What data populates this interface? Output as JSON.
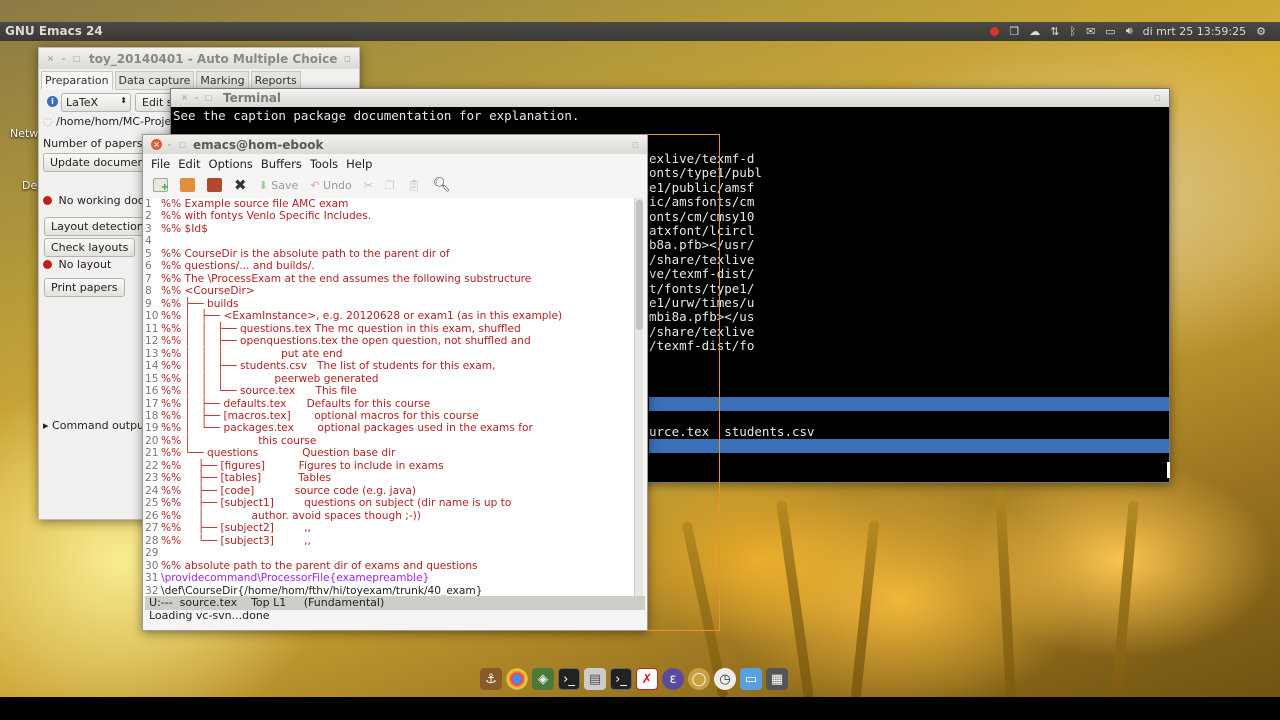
{
  "panel": {
    "app_title": "GNU Emacs 24",
    "datetime": "di mrt 25  13:59:25"
  },
  "desktop": {
    "label1": "Netw",
    "label2": "De"
  },
  "amc": {
    "title": "toy_20140401 - Auto Multiple Choice",
    "tabs": [
      "Preparation",
      "Data capture",
      "Marking",
      "Reports"
    ],
    "format_value": "LaTeX",
    "edit_label": "Edit so",
    "path": "/home/hom/MC-Proje",
    "num_papers_label": "Number of papers:",
    "update_btn": "Update document",
    "no_working_doc": "No working docu",
    "layout_detection_btn": "Layout detection",
    "check_layouts_btn": "Check layouts",
    "no_layout": "No layout",
    "print_papers_btn": "Print papers",
    "command_output": "Command output"
  },
  "terminal": {
    "title": "Terminal",
    "top_line": "See the caption package documentation for explanation.",
    "right_lines": [
      "exlive/texmf-d",
      "onts/type1/publ",
      "e1/public/amsf",
      "ic/amsfonts/cm",
      "onts/cm/cmsy10",
      "atxfont/lcircl",
      "b8a.pfb></usr/",
      "/share/texlive",
      "ve/texmf-dist/",
      "t/fonts/type1/",
      "e1/urw/times/u",
      "mbi8a.pfb></us",
      "/share/texlive",
      "/texmf-dist/fo"
    ],
    "files_line": "urce.tex  students.csv"
  },
  "emacs": {
    "title": "emacs@hom-ebook",
    "menu": [
      "File",
      "Edit",
      "Options",
      "Buffers",
      "Tools",
      "Help"
    ],
    "toolbar_save": "Save",
    "toolbar_undo": "Undo",
    "lines": [
      {
        "n": "1",
        "t": "%% Example source file AMC exam",
        "c": "cm"
      },
      {
        "n": "2",
        "t": "%% with fontys Venlo Specific Includes.",
        "c": "cm"
      },
      {
        "n": "3",
        "t": "%% $Id$",
        "c": "cm"
      },
      {
        "n": "4",
        "t": "",
        "c": "cm"
      },
      {
        "n": "5",
        "t": "%% CourseDir is the absolute path to the parent dir of",
        "c": "cm"
      },
      {
        "n": "6",
        "t": "%% questions/... and builds/.",
        "c": "cm"
      },
      {
        "n": "7",
        "t": "%% The \\ProcessExam at the end assumes the following substructure",
        "c": "cm"
      },
      {
        "n": "8",
        "t": "%% <CourseDir>",
        "c": "cm"
      },
      {
        "n": "9",
        "t": "%% ├── builds",
        "c": "cm"
      },
      {
        "n": "10",
        "t": "%% │   ├── <ExamInstance>, e.g. 20120628 or exam1 (as in this example)",
        "c": "cm"
      },
      {
        "n": "11",
        "t": "%% │   │   ├── questions.tex The mc question in this exam, shuffled",
        "c": "cm"
      },
      {
        "n": "12",
        "t": "%% │   │   ├── openquestions.tex the open question, not shuffled and",
        "c": "cm"
      },
      {
        "n": "13",
        "t": "%% │   │   │                 put ate end",
        "c": "cm"
      },
      {
        "n": "14",
        "t": "%% │   │   ├── students.csv   The list of students for this exam,",
        "c": "cm"
      },
      {
        "n": "15",
        "t": "%% │   │   │               peerweb generated",
        "c": "cm"
      },
      {
        "n": "16",
        "t": "%% │   │   └── source.tex      This file",
        "c": "cm"
      },
      {
        "n": "17",
        "t": "%% │   ├── defaults.tex      Defaults for this course",
        "c": "cm"
      },
      {
        "n": "18",
        "t": "%% │   ├── [macros.tex]       optional macros for this course",
        "c": "cm"
      },
      {
        "n": "19",
        "t": "%% │   └── packages.tex       optional packages used in the exams for",
        "c": "cm"
      },
      {
        "n": "20",
        "t": "%% │                    this course",
        "c": "cm"
      },
      {
        "n": "21",
        "t": "%% └── questions             Question base dir",
        "c": "cm"
      },
      {
        "n": "22",
        "t": "%%     ├── [figures]          Figures to include in exams",
        "c": "cm"
      },
      {
        "n": "23",
        "t": "%%     ├── [tables]           Tables",
        "c": "cm"
      },
      {
        "n": "24",
        "t": "%%     ├── [code]            source code (e.g. java)",
        "c": "cm"
      },
      {
        "n": "25",
        "t": "%%     ├── [subject1]         questions on subject (dir name is up to",
        "c": "cm"
      },
      {
        "n": "26",
        "t": "%%     │              author. avoid spaces though ;-))",
        "c": "cm"
      },
      {
        "n": "27",
        "t": "%%     ├── [subject2]         ,,",
        "c": "cm"
      },
      {
        "n": "28",
        "t": "%%     └── [subject3]         ,,",
        "c": "cm"
      },
      {
        "n": "29",
        "t": "",
        "c": "cm"
      },
      {
        "n": "30",
        "t": "%% absolute path to the parent dir of exams and questions",
        "c": "cm"
      },
      {
        "n": "31",
        "t": "\\providecommand\\ProcessorFile{examepreamble}",
        "c": "kw"
      },
      {
        "n": "32",
        "t": "\\def\\CourseDir{/home/hom/fthv/hi/toyexam/trunk/40_exam}",
        "c": "normal"
      }
    ],
    "modeline": "U:---  source.tex    Top L1     (Fundamental)",
    "minibuffer": "Loading vc-svn...done"
  },
  "colors": {
    "comment": "#b22222",
    "keyword": "#a020f0",
    "selection": "#3b6fb7",
    "resize_outline": "#e8922c"
  }
}
